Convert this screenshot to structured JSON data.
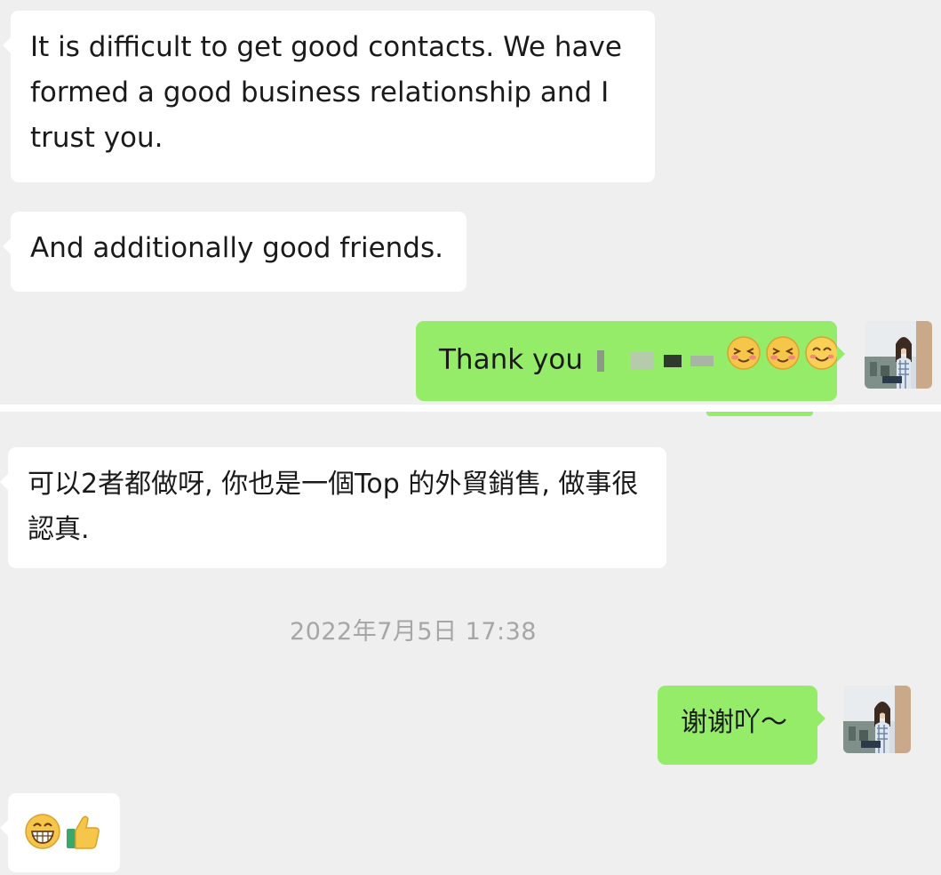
{
  "top_messages": [
    {
      "side": "received",
      "text": "It is difficult to get good contacts.  We have formed a good business relationship and I trust you."
    },
    {
      "side": "received",
      "text": "And additionally good friends."
    },
    {
      "side": "sent",
      "text": "Thank you",
      "redacted": true,
      "emojis": [
        "squinting-blush-emoji",
        "squinting-blush-emoji",
        "smiling-face-emoji"
      ]
    }
  ],
  "bottom_messages": [
    {
      "side": "received",
      "text": "可以2者都做呀, 你也是一個Top 的外貿銷售, 做事很認真."
    },
    {
      "side": "sent",
      "text": "谢谢吖～"
    },
    {
      "side": "received",
      "emojis": [
        "grinning-face-emoji",
        "thumbs-up-emoji"
      ]
    }
  ],
  "timestamp": "2022年7月5日 17:38",
  "colors": {
    "background": "#efefef",
    "received_bubble": "#ffffff",
    "sent_bubble": "#95ec69",
    "timestamp_text": "#a6a6a6"
  }
}
